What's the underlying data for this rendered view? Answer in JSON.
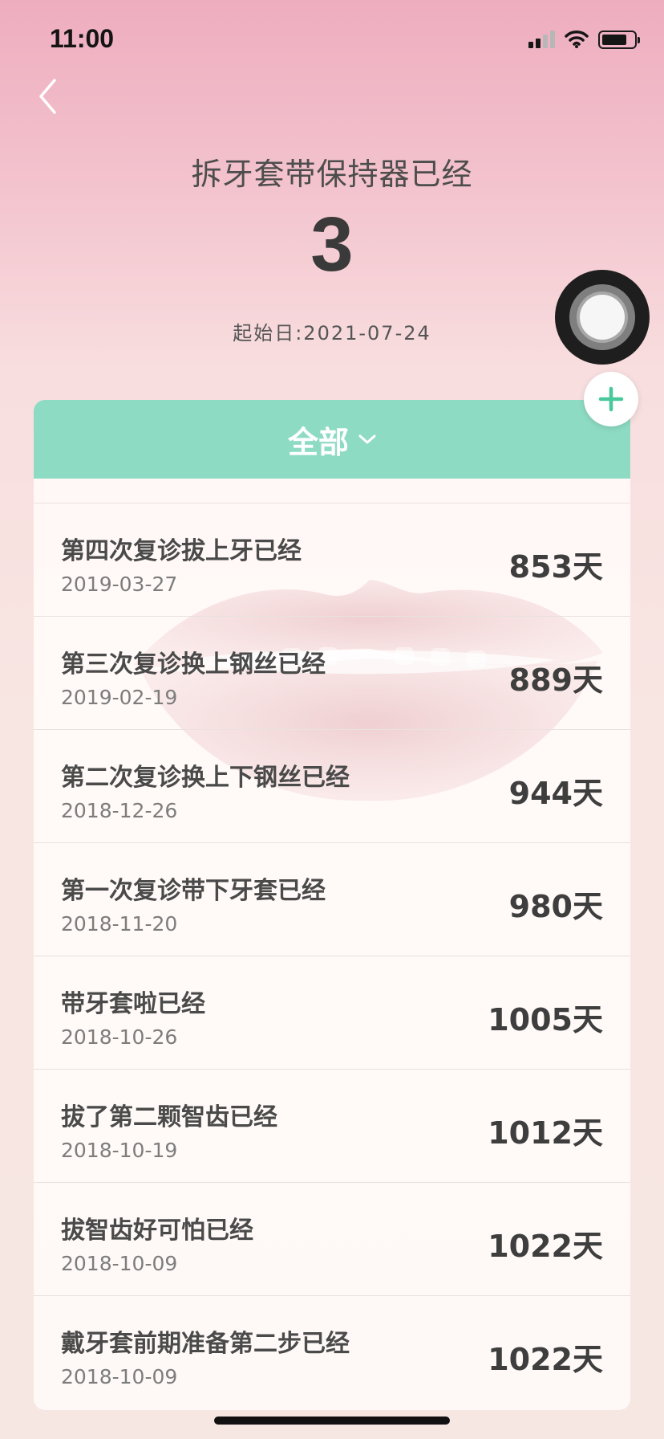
{
  "status_bar": {
    "time": "11:00"
  },
  "navigation": {
    "back_icon": "chevron-left-icon"
  },
  "header": {
    "title": "拆牙套带保持器已经",
    "count": "3",
    "start_date": "起始日:2021-07-24"
  },
  "filter": {
    "label": "全部",
    "icon": "chevron-down-icon"
  },
  "colors": {
    "accent": "#8edbc3",
    "card_background": "#fffbf9"
  },
  "records": [
    {
      "title": "第四次复诊拔上牙已经",
      "date": "2019-03-27",
      "days": "853天"
    },
    {
      "title": "第三次复诊换上钢丝已经",
      "date": "2019-02-19",
      "days": "889天"
    },
    {
      "title": "第二次复诊换上下钢丝已经",
      "date": "2018-12-26",
      "days": "944天"
    },
    {
      "title": "第一次复诊带下牙套已经",
      "date": "2018-11-20",
      "days": "980天"
    },
    {
      "title": "带牙套啦已经",
      "date": "2018-10-26",
      "days": "1005天"
    },
    {
      "title": "拔了第二颗智齿已经",
      "date": "2018-10-19",
      "days": "1012天"
    },
    {
      "title": "拔智齿好可怕已经",
      "date": "2018-10-09",
      "days": "1022天"
    },
    {
      "title": "戴牙套前期准备第二步已经",
      "date": "2018-10-09",
      "days": "1022天"
    }
  ]
}
